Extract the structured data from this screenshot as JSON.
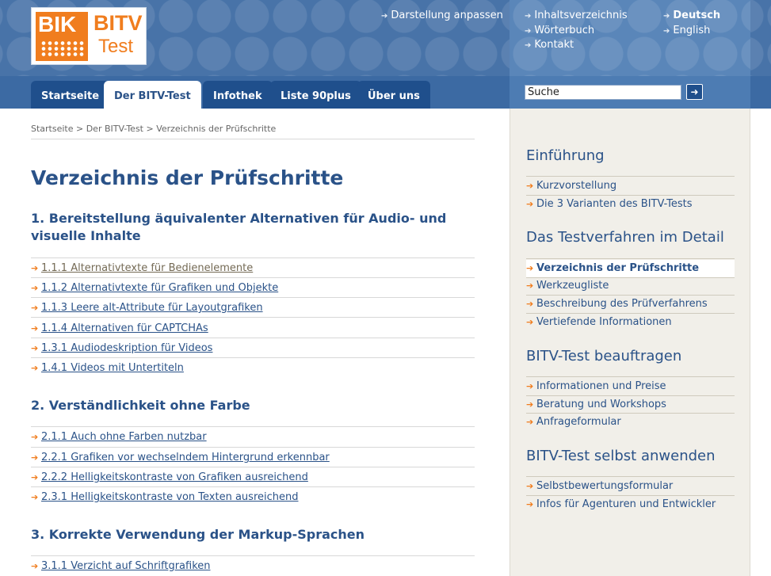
{
  "logo": {
    "bik": "BIK",
    "bitv": "BITV",
    "test": "Test"
  },
  "top_links": {
    "col1": [
      "Darstellung anpassen"
    ],
    "col2": [
      "Inhaltsverzeichnis",
      "Wörterbuch",
      "Kontakt"
    ],
    "col3": [
      "Deutsch",
      "English"
    ]
  },
  "tabs": [
    "Startseite",
    "Der BITV-Test",
    "Infothek",
    "Liste 90plus",
    "Über uns"
  ],
  "search": {
    "value": "Suche",
    "button": "➜"
  },
  "breadcrumb": "Startseite > Der BITV-Test > Verzeichnis der Prüfschritte",
  "page_title": "Verzeichnis der Prüfschritte",
  "sections": [
    {
      "heading": "1. Bereitstellung äquivalenter Alternativen für Audio- und visuelle Inhalte",
      "items": [
        "1.1.1 Alternativtexte für Bedienelemente",
        "1.1.2 Alternativtexte für Grafiken und Objekte",
        "1.1.3 Leere alt-Attribute für Layoutgrafiken",
        "1.1.4 Alternativen für CAPTCHAs",
        "1.3.1 Audiodeskription für Videos",
        "1.4.1 Videos mit Untertiteln"
      ]
    },
    {
      "heading": "2. Verständlichkeit ohne Farbe",
      "items": [
        "2.1.1 Auch ohne Farben nutzbar",
        "2.2.1 Grafiken vor wechselndem Hintergrund erkennbar",
        "2.2.2 Helligkeitskontraste von Grafiken ausreichend",
        "2.3.1 Helligkeitskontraste von Texten ausreichend"
      ]
    },
    {
      "heading": "3. Korrekte Verwendung der Markup-Sprachen",
      "items": [
        "3.1.1 Verzicht auf Schriftgrafiken"
      ]
    }
  ],
  "sidebar": {
    "groups": [
      {
        "heading": "Einführung",
        "items": [
          "Kurzvorstellung",
          "Die 3 Varianten des BITV-Tests"
        ]
      },
      {
        "heading": "Das Testverfahren im Detail",
        "items": [
          "Verzeichnis der Prüfschritte",
          "Werkzeugliste",
          "Beschreibung des Prüfverfahrens",
          "Vertiefende Informationen"
        ]
      },
      {
        "heading": "BITV-Test beauftragen",
        "items": [
          "Informationen und Preise",
          "Beratung und Workshops",
          "Anfrageformular"
        ]
      },
      {
        "heading": "BITV-Test selbst anwenden",
        "items": [
          "Selbstbewertungsformular",
          "Infos für Agenturen und Entwickler"
        ]
      }
    ]
  },
  "colors": {
    "brand_blue": "#2a5288",
    "accent_orange": "#f07d1e",
    "header_blue": "#4873a8",
    "sidebar_bg": "#f1efe9"
  },
  "icons": {
    "arrow": "arrow-right-icon"
  }
}
